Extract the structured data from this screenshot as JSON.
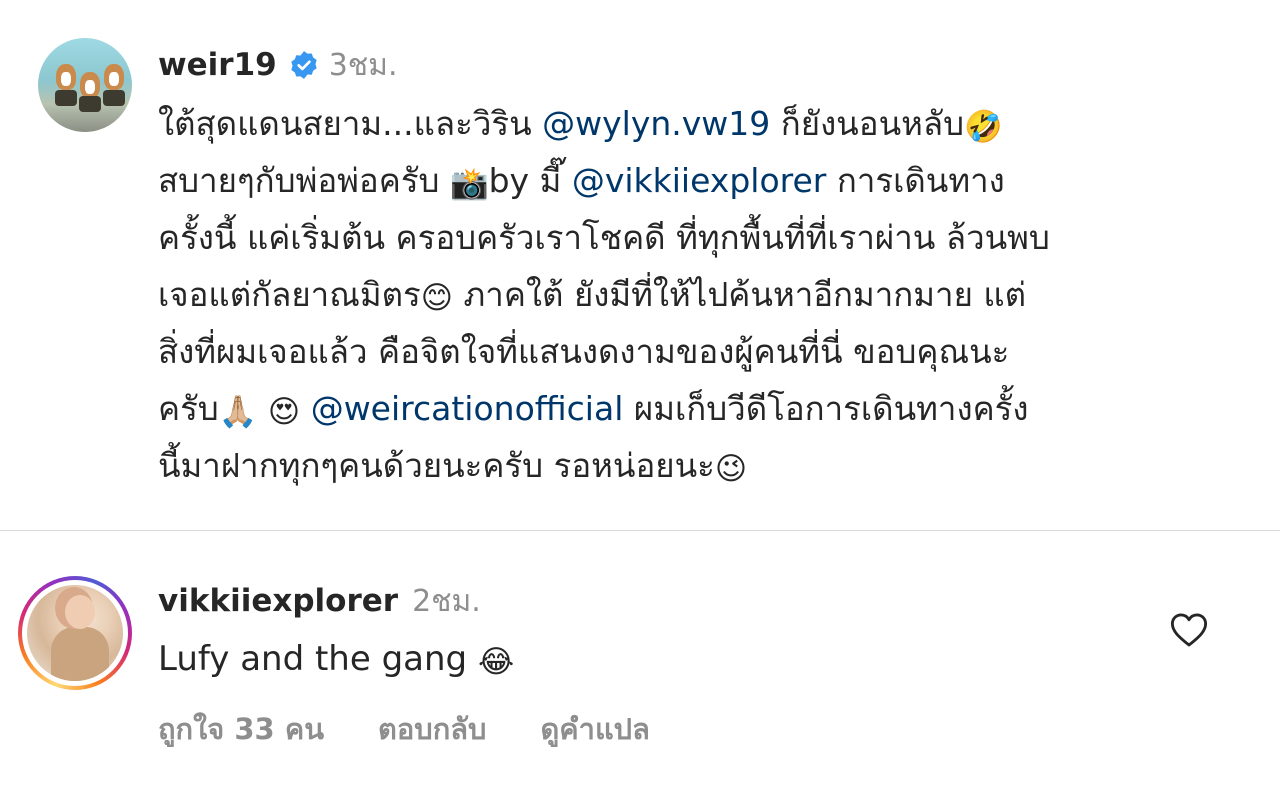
{
  "post": {
    "username": "weir19",
    "time": "3ชม.",
    "caption_lines": [
      [
        {
          "text": "ใต้สุดแดนสยาม...และวิริน "
        },
        {
          "mention": "@wylyn.vw19"
        },
        {
          "text": " ก็ยังนอนหลับ"
        },
        {
          "emoji": "🤣",
          "name": "rofl-emoji"
        }
      ],
      [
        {
          "text": "สบายๆกับพ่อพ่อครับ "
        },
        {
          "emoji": "📸",
          "name": "camera-flash-emoji"
        },
        {
          "text": "by มี๊ "
        },
        {
          "mention": "@vikkiiexplorer"
        },
        {
          "text": " การเดินทาง"
        }
      ],
      [
        {
          "text": "ครั้งนี้ แค่เริ่มต้น ครอบครัวเราโชคดี ที่ทุกพื้นที่ที่เราผ่าน ล้วนพบ"
        }
      ],
      [
        {
          "text": "เจอแต่กัลยาณมิตร"
        },
        {
          "emoji": "😊",
          "name": "smiling-emoji"
        },
        {
          "text": "  ภาคใต้ ยังมีที่ให้ไปค้นหาอีกมากมาย แต่"
        }
      ],
      [
        {
          "text": "สิ่งที่ผมเจอแล้ว คือจิตใจที่แสนงดงามของผู้คนที่นี่ ขอบคุณนะ"
        }
      ],
      [
        {
          "text": "ครับ"
        },
        {
          "emoji": "🙏🏼",
          "name": "folded-hands-emoji"
        },
        {
          "text": " "
        },
        {
          "emoji": "😍",
          "name": "heart-eyes-emoji"
        },
        {
          "text": " "
        },
        {
          "mention": "@weircationofficial"
        },
        {
          "text": "  ผมเก็บวีดีโอการเดินทางครั้ง"
        }
      ],
      [
        {
          "text": "นี้มาฝากทุกๆคนด้วยนะครับ รอหน่อยนะ"
        },
        {
          "emoji": "😉",
          "name": "winking-emoji"
        }
      ]
    ]
  },
  "comment": {
    "username": "vikkiiexplorer",
    "time": "2ชม.",
    "text": "Lufy and the gang ",
    "emoji": "😂",
    "actions": {
      "likes": "ถูกใจ 33 คน",
      "reply": "ตอบกลับ",
      "translate": "ดูคำแปล"
    }
  },
  "colors": {
    "text": "#262626",
    "secondary": "#8e8e8e",
    "mention": "#00376b",
    "verified": "#3897f0",
    "divider": "#dbdbdb"
  },
  "icons": [
    "verified-badge-icon",
    "heart-icon"
  ]
}
